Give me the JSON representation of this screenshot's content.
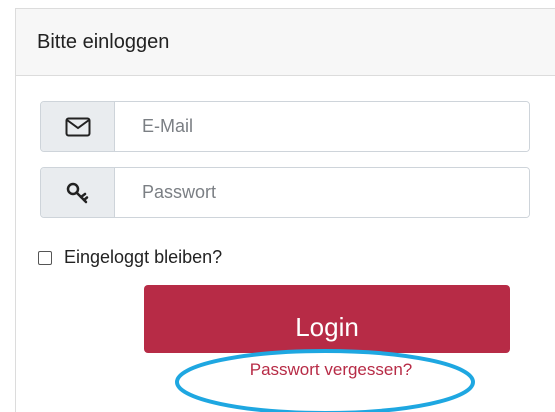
{
  "panel": {
    "title": "Bitte einloggen"
  },
  "form": {
    "email": {
      "icon": "envelope-icon",
      "placeholder": "E-Mail",
      "value": ""
    },
    "password": {
      "icon": "key-icon",
      "placeholder": "Passwort",
      "value": ""
    },
    "remember": {
      "label": "Eingeloggt bleiben?",
      "checked": false
    },
    "login_label": "Login",
    "forgot_label": "Passwort vergessen?"
  },
  "colors": {
    "accent": "#b72b46",
    "highlight": "#1ea7e1",
    "addon_bg": "#e9ecef",
    "header_bg": "#f7f7f7"
  }
}
